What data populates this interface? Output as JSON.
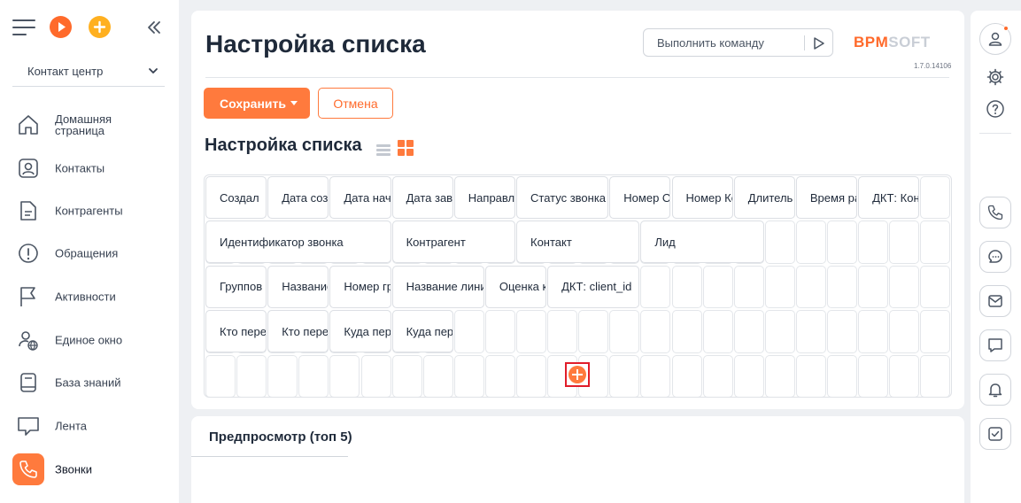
{
  "sidebar": {
    "workspace": "Контакт центр",
    "items": [
      {
        "label": "Домашняя страница",
        "icon": "home-icon"
      },
      {
        "label": "Контакты",
        "icon": "contact-icon"
      },
      {
        "label": "Контрагенты",
        "icon": "document-icon"
      },
      {
        "label": "Обращения",
        "icon": "alert-icon"
      },
      {
        "label": "Активности",
        "icon": "flag-icon"
      },
      {
        "label": "Единое окно",
        "icon": "user-globe-icon"
      },
      {
        "label": "База знаний",
        "icon": "book-icon"
      },
      {
        "label": "Лента",
        "icon": "chat-icon"
      },
      {
        "label": "Звонки",
        "icon": "phone-icon",
        "active": true
      }
    ]
  },
  "header": {
    "title": "Настройка списка",
    "command_placeholder": "Выполнить команду",
    "logo_part1": "BPM",
    "logo_part2": "SOFT",
    "version": "1.7.0.14106"
  },
  "toolbar": {
    "save_label": "Сохранить",
    "cancel_label": "Отмена"
  },
  "list_settings": {
    "title": "Настройка списка",
    "rows": [
      [
        "Создал",
        "Дата соз",
        "Дата нач",
        "Дата зав",
        "Направле",
        "Статус звонка",
        "Номер От",
        "Номер Ко",
        "Длитель",
        "Время ра",
        "ДКТ: Кон"
      ],
      [
        "Идентификатор звонка",
        "Контрагент",
        "Контакт",
        "Лид"
      ],
      [
        "Группов",
        "Название",
        "Номер гр",
        "Название лини",
        "Оценка к",
        "ДКТ: client_id"
      ],
      [
        "Кто пере",
        "Кто пере",
        "Куда пер",
        "Куда пер"
      ]
    ]
  },
  "preview": {
    "title": "Предпросмотр (топ 5)"
  },
  "colors": {
    "accent": "#ff7a3d",
    "highlight": "#e11d2a"
  }
}
